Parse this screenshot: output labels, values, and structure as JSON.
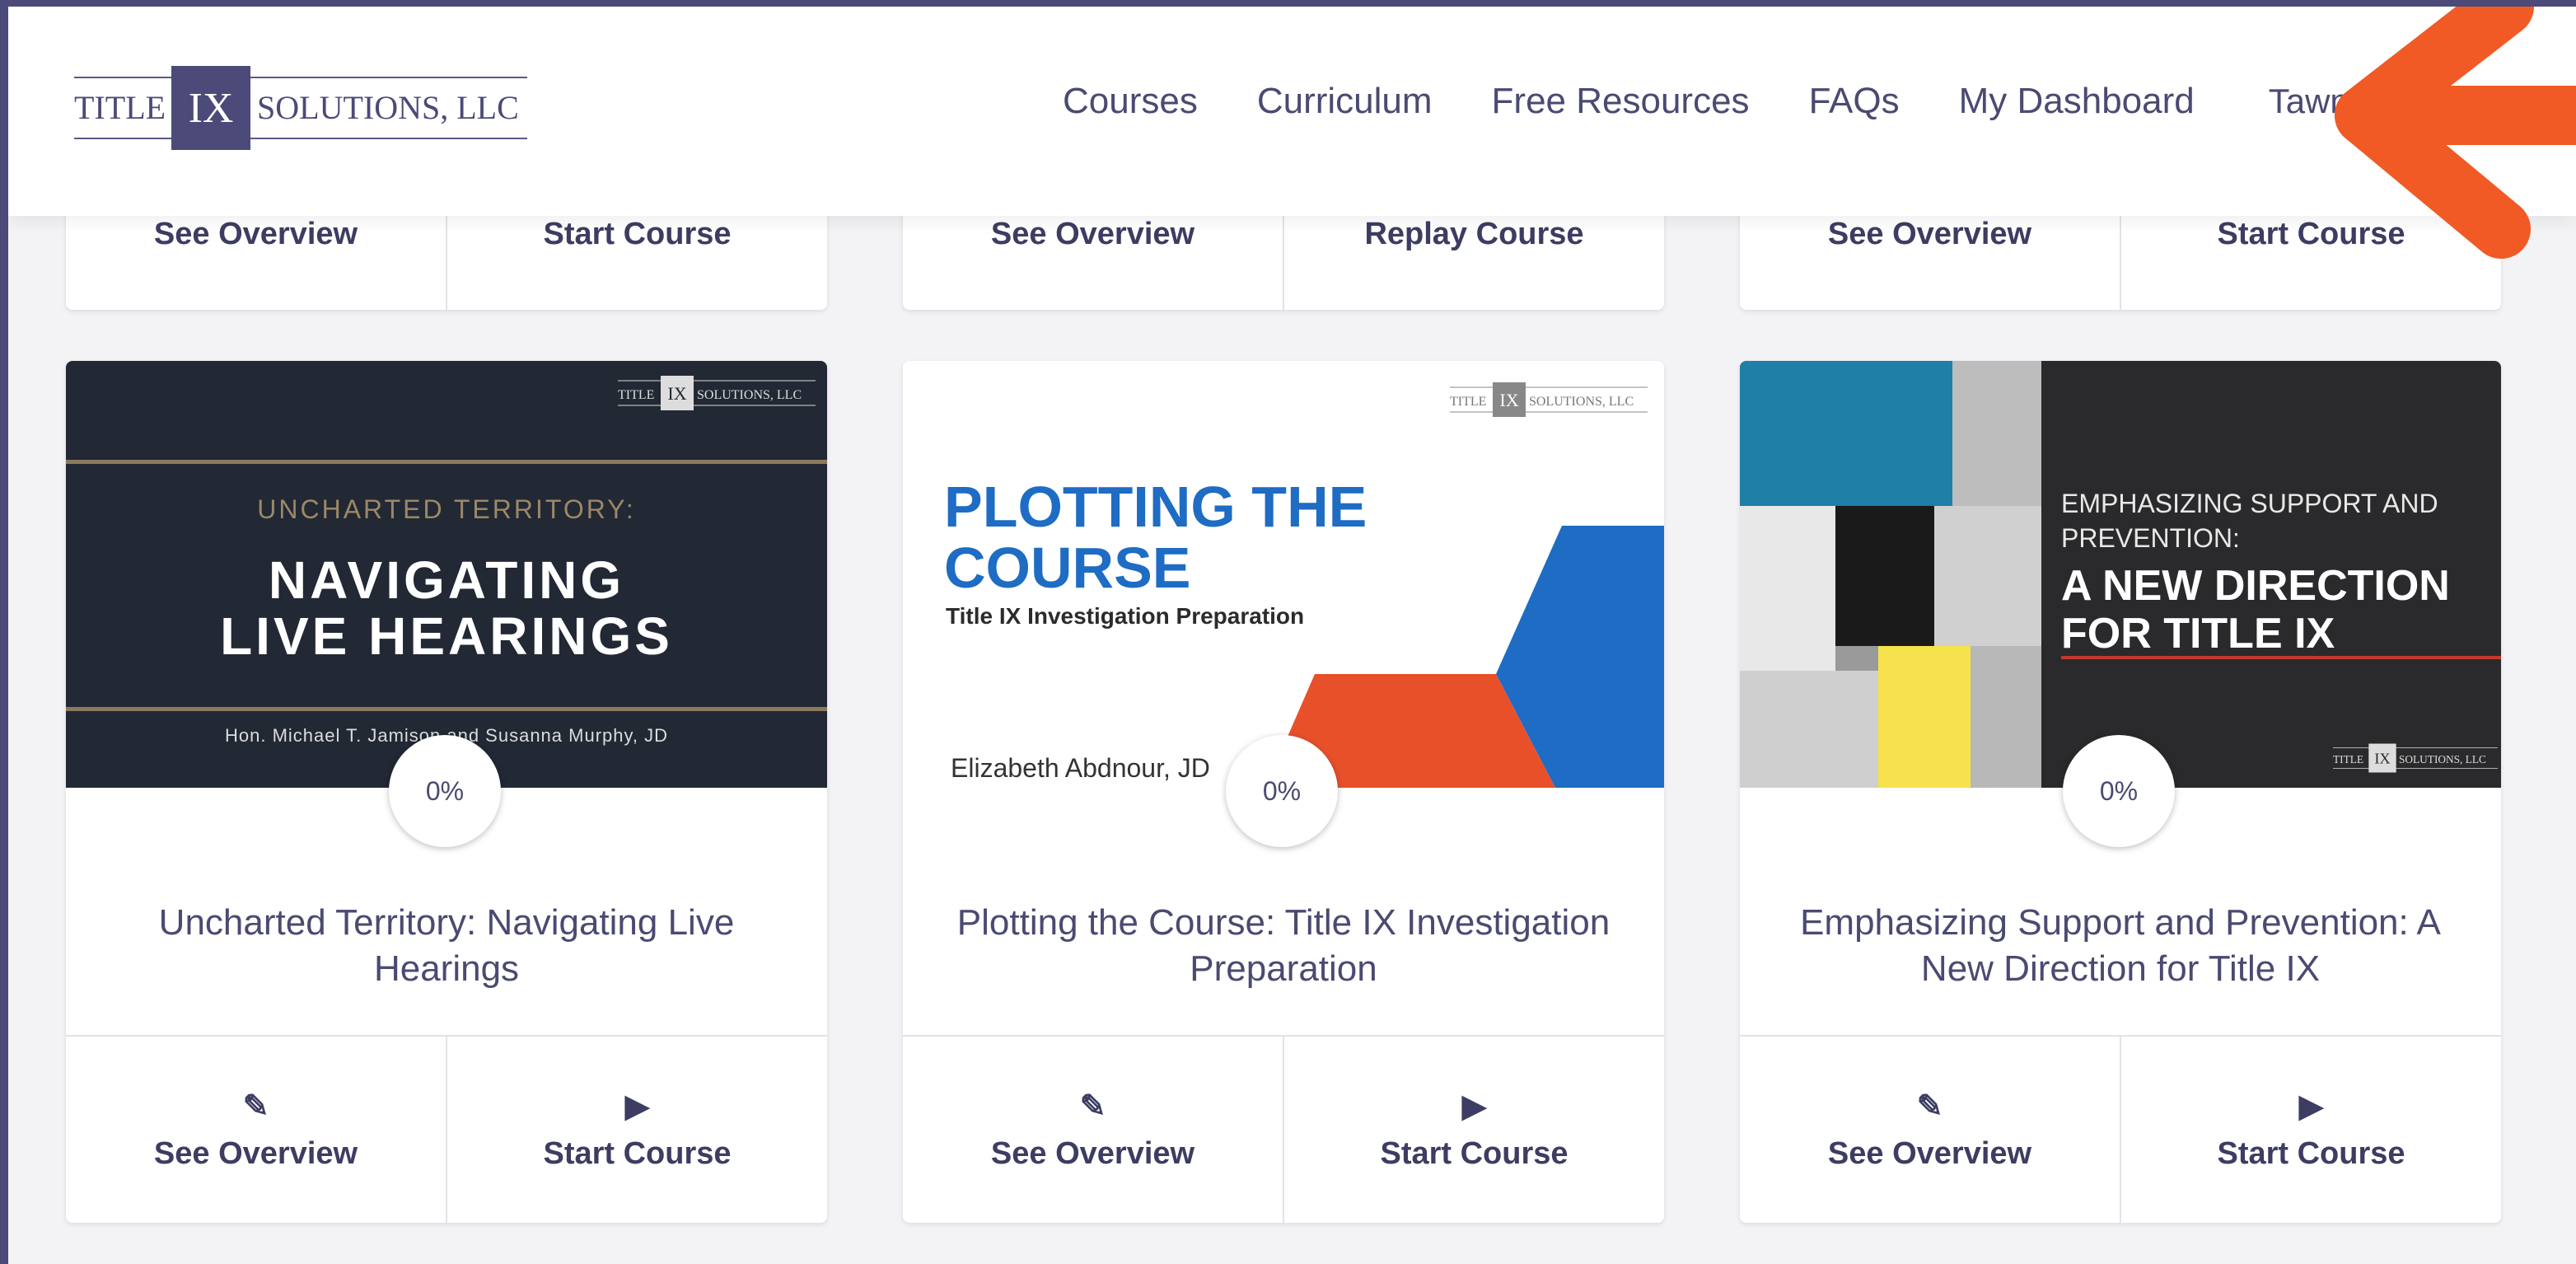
{
  "header": {
    "logo": {
      "left": "TITLE",
      "mid": "IX",
      "right": "SOLUTIONS, LLC"
    },
    "nav": [
      "Courses",
      "Curriculum",
      "Free Resources",
      "FAQs",
      "My Dashboard"
    ],
    "user": "Tawny A"
  },
  "colors": {
    "accent": "#f15a24",
    "brand": "#4b4a78"
  },
  "top_cards": [
    {
      "overview": "See Overview",
      "action": "Start Course"
    },
    {
      "overview": "See Overview",
      "action": "Replay Course"
    },
    {
      "overview": "See Overview",
      "action": "Start Course"
    }
  ],
  "courses": [
    {
      "thumb": {
        "pre": "UNCHARTED TERRITORY:",
        "line1": "NAVIGATING",
        "line2": "LIVE HEARINGS",
        "authors": "Hon. Michael T. Jamison and Susanna Murphy, JD"
      },
      "progress": "0%",
      "title": "Uncharted Territory: Navigating Live Hearings",
      "overview": "See Overview",
      "action": "Start Course"
    },
    {
      "thumb": {
        "line1": "PLOTTING THE",
        "line2": "COURSE",
        "sub": "Title IX Investigation Preparation",
        "author": "Elizabeth Abdnour, JD"
      },
      "progress": "0%",
      "title": "Plotting the Course: Title IX Investigation Preparation",
      "overview": "See Overview",
      "action": "Start Course"
    },
    {
      "thumb": {
        "pre1": "EMPHASIZING SUPPORT AND",
        "pre2": "PREVENTION:",
        "line1": "A NEW DIRECTION",
        "line2": "FOR TITLE IX"
      },
      "progress": "0%",
      "title": "Emphasizing Support and Prevention: A New Direction for Title IX",
      "overview": "See Overview",
      "action": "Start Course"
    }
  ]
}
